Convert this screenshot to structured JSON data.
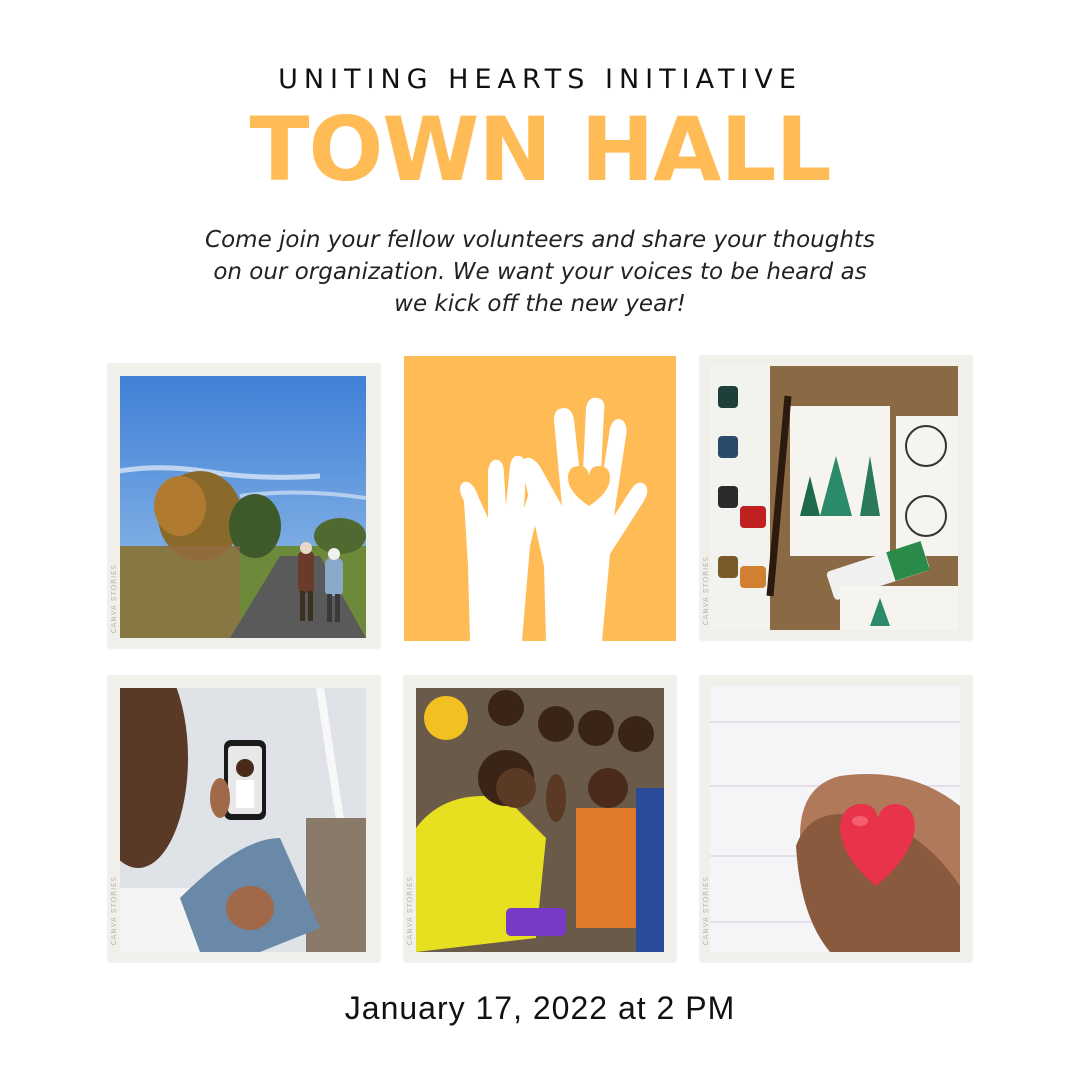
{
  "header": {
    "subtitle": "UNITING HEARTS INITIATIVE",
    "title": "TOWN HALL"
  },
  "description": "Come join your fellow volunteers and share your thoughts on our organization. We want your voices to be heard as we kick off the new year!",
  "frame_text": "CANVA STORIES",
  "event": {
    "date": "January 17, 2022 at 2 PM"
  },
  "colors": {
    "accent": "#ffbb55",
    "frame": "#f1efea"
  },
  "photos": [
    {
      "name": "elderly-couple-walking-photo",
      "icon": "park-path-scene"
    },
    {
      "name": "raised-hands-heart-logo",
      "icon": "hands-heart-icon"
    },
    {
      "name": "christmas-card-painting-photo",
      "icon": "watercolor-cards-scene"
    },
    {
      "name": "video-call-phone-photo",
      "icon": "phone-video-call-scene"
    },
    {
      "name": "volunteer-with-children-photo",
      "icon": "group-children-scene"
    },
    {
      "name": "hands-holding-heart-photo",
      "icon": "heart-in-hands-scene"
    }
  ]
}
